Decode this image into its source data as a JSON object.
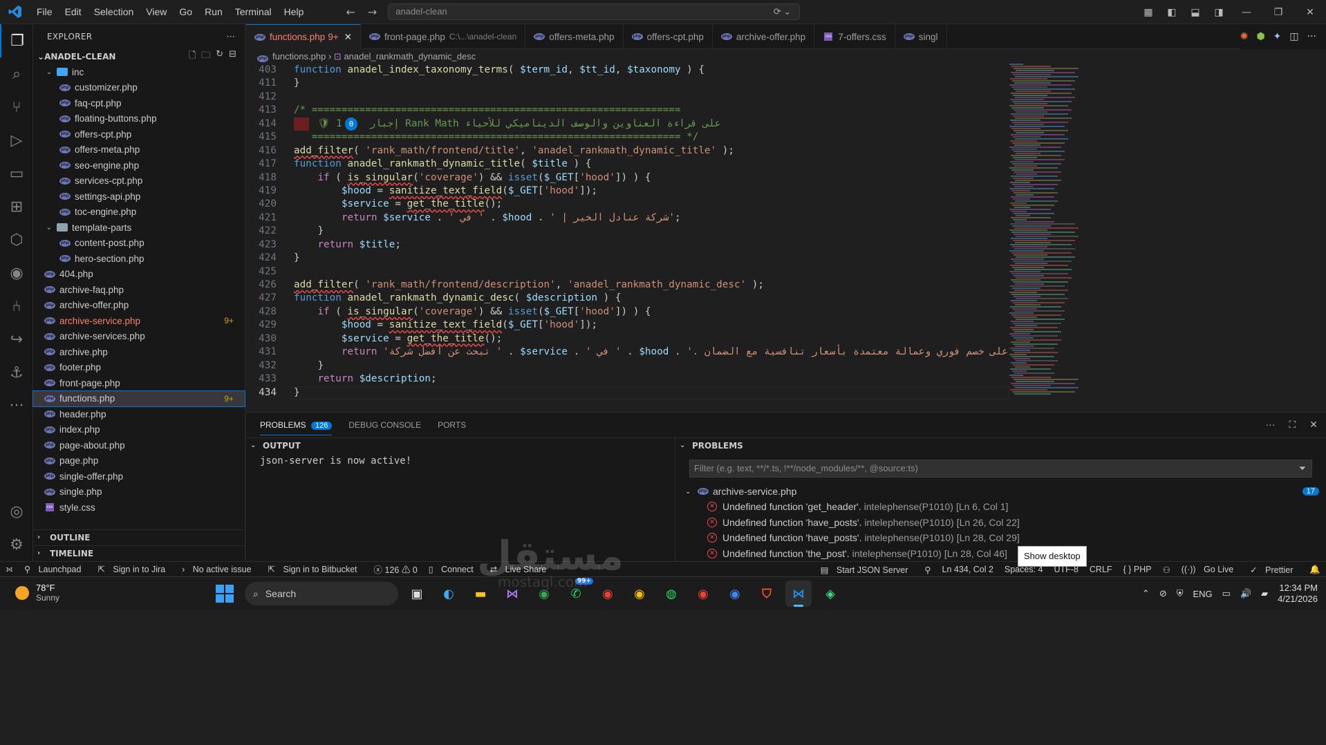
{
  "titlebar": {
    "menu": [
      "File",
      "Edit",
      "Selection",
      "View",
      "Go",
      "Run",
      "Terminal",
      "Help"
    ],
    "command_center": "anadel-clean"
  },
  "explorer": {
    "title": "EXPLORER",
    "folder": "ANADEL-CLEAN",
    "items": [
      {
        "label": "inc",
        "type": "folder-open",
        "depth": 1
      },
      {
        "label": "customizer.php",
        "type": "php",
        "depth": 2
      },
      {
        "label": "faq-cpt.php",
        "type": "php",
        "depth": 2
      },
      {
        "label": "floating-buttons.php",
        "type": "php",
        "depth": 2
      },
      {
        "label": "offers-cpt.php",
        "type": "php",
        "depth": 2
      },
      {
        "label": "offers-meta.php",
        "type": "php",
        "depth": 2
      },
      {
        "label": "seo-engine.php",
        "type": "php",
        "depth": 2
      },
      {
        "label": "services-cpt.php",
        "type": "php",
        "depth": 2
      },
      {
        "label": "settings-api.php",
        "type": "php",
        "depth": 2
      },
      {
        "label": "toc-engine.php",
        "type": "php",
        "depth": 2
      },
      {
        "label": "template-parts",
        "type": "folder-open",
        "depth": 1
      },
      {
        "label": "content-post.php",
        "type": "php",
        "depth": 2
      },
      {
        "label": "hero-section.php",
        "type": "php",
        "depth": 2
      },
      {
        "label": "404.php",
        "type": "php",
        "depth": 1
      },
      {
        "label": "archive-faq.php",
        "type": "php",
        "depth": 1
      },
      {
        "label": "archive-offer.php",
        "type": "php",
        "depth": 1
      },
      {
        "label": "archive-service.php",
        "type": "php",
        "depth": 1,
        "badge": "9+",
        "error": true
      },
      {
        "label": "archive-services.php",
        "type": "php",
        "depth": 1
      },
      {
        "label": "archive.php",
        "type": "php",
        "depth": 1
      },
      {
        "label": "footer.php",
        "type": "php",
        "depth": 1
      },
      {
        "label": "front-page.php",
        "type": "php",
        "depth": 1
      },
      {
        "label": "functions.php",
        "type": "php",
        "depth": 1,
        "badge": "9+",
        "selected": true
      },
      {
        "label": "header.php",
        "type": "php",
        "depth": 1
      },
      {
        "label": "index.php",
        "type": "php",
        "depth": 1
      },
      {
        "label": "page-about.php",
        "type": "php",
        "depth": 1
      },
      {
        "label": "page.php",
        "type": "php",
        "depth": 1
      },
      {
        "label": "single-offer.php",
        "type": "php",
        "depth": 1
      },
      {
        "label": "single.php",
        "type": "php",
        "depth": 1
      },
      {
        "label": "style.css",
        "type": "css",
        "depth": 1
      }
    ],
    "outline": "OUTLINE",
    "timeline": "TIMELINE"
  },
  "tabs": [
    {
      "label": "functions.php",
      "badge": "9+",
      "active": true
    },
    {
      "label": "front-page.php",
      "sub": "C:\\...\\anadel-clean"
    },
    {
      "label": "offers-meta.php"
    },
    {
      "label": "offers-cpt.php"
    },
    {
      "label": "archive-offer.php"
    },
    {
      "label": "7-offers.css"
    },
    {
      "label": "singl"
    }
  ],
  "breadcrumb": {
    "file": "functions.php",
    "symbol": "anadel_rankmath_dynamic_desc"
  },
  "editor": {
    "current_line": "434",
    "lines": [
      {
        "n": "403",
        "html": "<span class='k'>function</span> <span class='f'>anadel_index_taxonomy_terms</span><span class='p'>( </span><span class='v'>$term_id</span><span class='p'>, </span><span class='v'>$tt_id</span><span class='p'>, </span><span class='v'>$taxonomy</span><span class='p'> ) {</span>"
      },
      {
        "n": "411",
        "html": "<span class='p'>}</span>"
      },
      {
        "n": "412",
        "html": ""
      },
      {
        "n": "413",
        "html": "<span class='c'>/* ==============================================================</span>"
      },
      {
        "n": "414",
        "html": "<span class='c'>    🛡 1</span><span class='count-badge'>0</span><span class='c'>  إجبار Rank Math على قراءة العناوين والوصف الديناميكي للأحياء</span>"
      },
      {
        "n": "415",
        "html": "<span class='c'>   ============================================================== */</span>"
      },
      {
        "n": "416",
        "html": "<span class='f sq'>add_filter</span><span class='p'>( </span><span class='s'>'rank_math/frontend/title'</span><span class='p'>, </span><span class='s'>'anadel_rankmath_dynamic_title'</span><span class='p'> );</span>"
      },
      {
        "n": "417",
        "html": "<span class='k'>function</span> <span class='f'>anadel_rankmath_dynamic_title</span><span class='p'>( </span><span class='v'>$title</span><span class='p'> ) {</span>"
      },
      {
        "n": "418",
        "html": "    <span class='kw'>if</span><span class='p'> ( </span><span class='f sq'>is_singular</span><span class='p'>(</span><span class='s'>'coverage'</span><span class='p'>) &amp;&amp; </span><span class='k'>isset</span><span class='p'>(</span><span class='v'>$_GET</span><span class='p'>[</span><span class='s'>'hood'</span><span class='p'>]) ) {</span>"
      },
      {
        "n": "419",
        "html": "        <span class='v'>$hood</span><span class='p'> = </span><span class='f sq'>sanitize_text_field</span><span class='p'>(</span><span class='v'>$_GET</span><span class='p'>[</span><span class='s'>'hood'</span><span class='p'>]);</span>"
      },
      {
        "n": "420",
        "html": "        <span class='v'>$service</span><span class='p'> = </span><span class='f sq'>get_the_title</span><span class='p'>();</span>"
      },
      {
        "n": "421",
        "html": "        <span class='kw'>return</span><span class='p'> </span><span class='v'>$service</span><span class='p'> . </span><span class='s'>' في '</span><span class='p'> . </span><span class='v'>$hood</span><span class='p'> . </span><span class='s'>' | شركة عنادل الخير'</span><span class='p'>;</span>"
      },
      {
        "n": "422",
        "html": "    <span class='p'>}</span>"
      },
      {
        "n": "423",
        "html": "    <span class='kw'>return</span><span class='p'> </span><span class='v'>$title</span><span class='p'>;</span>"
      },
      {
        "n": "424",
        "html": "<span class='p'>}</span>"
      },
      {
        "n": "425",
        "html": ""
      },
      {
        "n": "426",
        "html": "<span class='f sq'>add_filter</span><span class='p'>( </span><span class='s'>'rank_math/frontend/description'</span><span class='p'>, </span><span class='s'>'anadel_rankmath_dynamic_desc'</span><span class='p'> );</span>"
      },
      {
        "n": "427",
        "html": "<span class='k'>function</span> <span class='f'>anadel_rankmath_dynamic_desc</span><span class='p'>( </span><span class='v'>$description</span><span class='p'> ) {</span>"
      },
      {
        "n": "428",
        "html": "    <span class='kw'>if</span><span class='p'> ( </span><span class='f sq'>is_singular</span><span class='p'>(</span><span class='s'>'coverage'</span><span class='p'>) &amp;&amp; </span><span class='k'>isset</span><span class='p'>(</span><span class='v'>$_GET</span><span class='p'>[</span><span class='s'>'hood'</span><span class='p'>]) ) {</span>"
      },
      {
        "n": "429",
        "html": "        <span class='v'>$hood</span><span class='p'> = </span><span class='f sq'>sanitize_text_field</span><span class='p'>(</span><span class='v'>$_GET</span><span class='p'>[</span><span class='s'>'hood'</span><span class='p'>]);</span>"
      },
      {
        "n": "430",
        "html": "        <span class='v'>$service</span><span class='p'> = </span><span class='f sq'>get_the_title</span><span class='p'>();</span>"
      },
      {
        "n": "431",
        "html": "        <span class='kw'>return</span><span class='p'> </span><span class='s'>'تبحث عن أفضل شركة '</span><span class='p'> . </span><span class='v'>$service</span><span class='p'> . </span><span class='s'>' في '</span><span class='p'> . </span><span class='v'>$hood</span><span class='p'> . </span><span class='s'>'. اتصل الآن للحصول على خصم فوري وعمالة معتمدة بأسعار تنافسية مع الضمان.'</span>"
      },
      {
        "n": "432",
        "html": "    <span class='p'>}</span>"
      },
      {
        "n": "433",
        "html": "    <span class='kw'>return</span><span class='p'> </span><span class='v'>$description</span><span class='p'>;</span>"
      },
      {
        "n": "434",
        "html": "<span class='p'>}</span>"
      }
    ]
  },
  "panel": {
    "tabs": {
      "problems": "PROBLEMS",
      "problems_count": "126",
      "debug": "DEBUG CONSOLE",
      "ports": "PORTS"
    },
    "output": {
      "title": "OUTPUT",
      "text": "json-server is now active!"
    },
    "problems": {
      "title": "PROBLEMS",
      "filter_placeholder": "Filter (e.g. text, **/*.ts, !**/node_modules/**, @source:ts)",
      "file": "archive-service.php",
      "file_count": "17",
      "items": [
        {
          "msg": "Undefined function 'get_header'.",
          "src": "intelephense(P1010)",
          "loc": "[Ln 6, Col 1]"
        },
        {
          "msg": "Undefined function 'have_posts'.",
          "src": "intelephense(P1010)",
          "loc": "[Ln 26, Col 22]"
        },
        {
          "msg": "Undefined function 'have_posts'.",
          "src": "intelephense(P1010)",
          "loc": "[Ln 28, Col 29]"
        },
        {
          "msg": "Undefined function 'the_post'.",
          "src": "intelephense(P1010)",
          "loc": "[Ln 28, Col 46]"
        }
      ]
    }
  },
  "statusbar": {
    "left": [
      "Launchpad",
      "Sign in to Jira",
      "No active issue",
      "Sign in to Bitbucket",
      "ⓧ 126 ⚠ 0",
      "Connect",
      "Live Share"
    ],
    "right": [
      "Start JSON Server",
      "Ln 434, Col 2",
      "Spaces: 4",
      "UTF-8",
      "CRLF",
      "{ } PHP",
      "Go Live",
      "Prettier"
    ],
    "tooltip": "Show desktop"
  },
  "taskbar": {
    "temp": "78°F",
    "condition": "Sunny",
    "search": "Search",
    "lang": "ENG",
    "time": "12:34 PM",
    "date": "4/21/2026",
    "badge": "99+"
  },
  "watermark": {
    "main": "مستقل",
    "sub": "mostaql.com"
  }
}
